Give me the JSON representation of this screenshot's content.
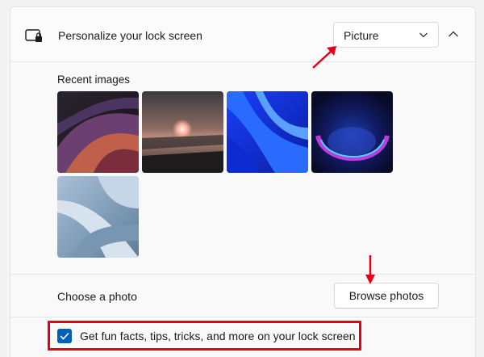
{
  "lock_screen": {
    "title": "Personalize your lock screen",
    "mode_dropdown": {
      "value": "Picture"
    }
  },
  "recent_images": {
    "label": "Recent images",
    "items": [
      "purple-swirl-wallpaper",
      "sunset-lake-wallpaper",
      "blue-bloom-wallpaper",
      "purple-glow-wallpaper",
      "pale-blue-bloom-wallpaper"
    ]
  },
  "choose_photo": {
    "label": "Choose a photo",
    "button": "Browse photos"
  },
  "fun_facts": {
    "label": "Get fun facts, tips, tricks, and more on your lock screen",
    "checked": true
  },
  "colors": {
    "accent": "#005fb8",
    "annotation": "#e3001b"
  }
}
